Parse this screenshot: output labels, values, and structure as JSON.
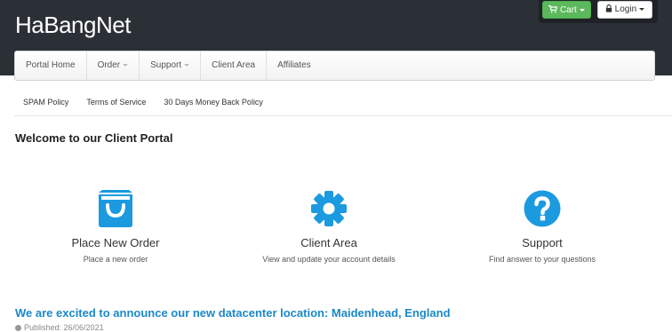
{
  "header": {
    "brand": "HaBangNet",
    "cart_label": "Cart",
    "login_label": "Login"
  },
  "nav": {
    "items": [
      {
        "label": "Portal Home"
      },
      {
        "label": "Order"
      },
      {
        "label": "Support"
      },
      {
        "label": "Client Area"
      },
      {
        "label": "Affiliates"
      }
    ]
  },
  "subnav": {
    "items": [
      {
        "label": "SPAM Policy"
      },
      {
        "label": "Terms of Service"
      },
      {
        "label": "30 Days Money Back Policy"
      }
    ]
  },
  "main": {
    "welcome": "Welcome to our Client Portal",
    "features": [
      {
        "icon": "shopping-bag-icon",
        "title": "Place New Order",
        "desc": "Place a new order"
      },
      {
        "icon": "gear-icon",
        "title": "Client Area",
        "desc": "View and update your account details"
      },
      {
        "icon": "question-circle-icon",
        "title": "Support",
        "desc": "Find answer to your questions"
      }
    ],
    "accent_color": "#1b88c9"
  },
  "announcement": {
    "title": "We are excited to announce our new datacenter location: Maidenhead, England",
    "published": "Published: 26/06/2021"
  }
}
